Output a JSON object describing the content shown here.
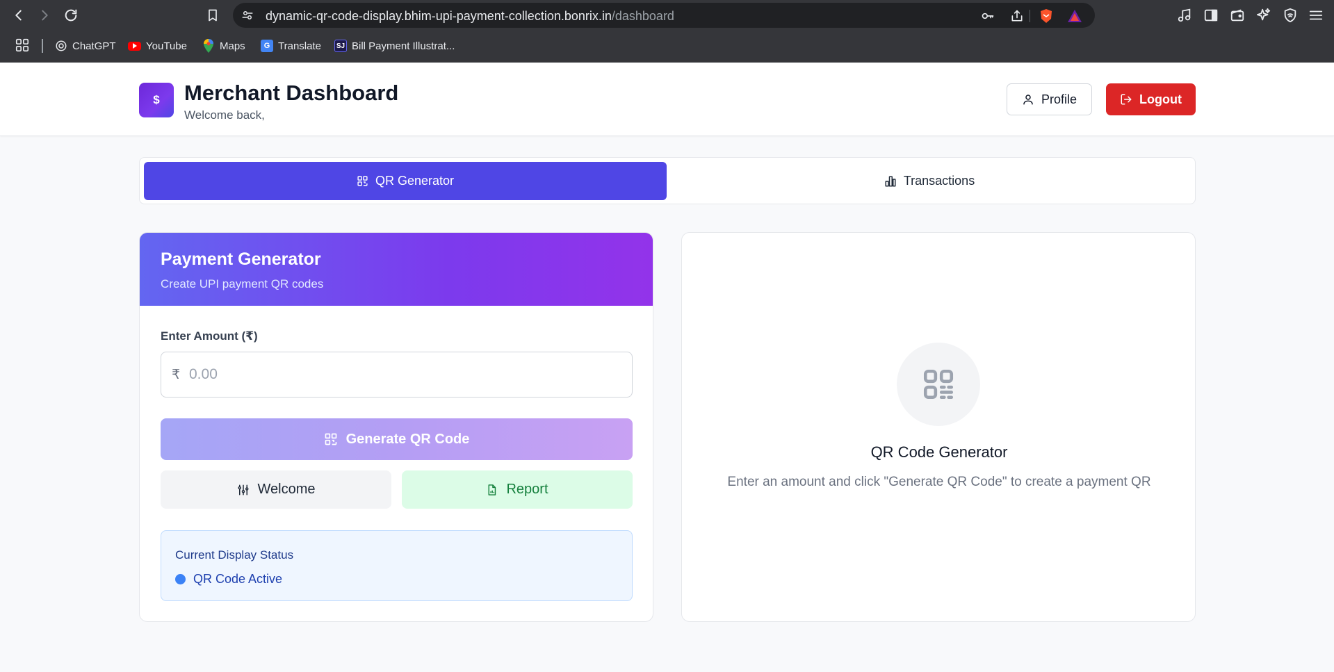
{
  "browser": {
    "url_host": "dynamic-qr-code-display.bhim-upi-payment-collection.bonrix.in",
    "url_path": "/dashboard",
    "bookmarks": [
      {
        "label": "ChatGPT",
        "icon": "chatgpt-icon"
      },
      {
        "label": "YouTube",
        "icon": "youtube-icon"
      },
      {
        "label": "Maps",
        "icon": "maps-icon"
      },
      {
        "label": "Translate",
        "icon": "translate-icon"
      },
      {
        "label": "Bill Payment Illustrat...",
        "icon": "bill-payment-icon"
      }
    ]
  },
  "header": {
    "logo_symbol": "$",
    "title": "Merchant Dashboard",
    "subtitle": "Welcome back,",
    "profile_label": "Profile",
    "logout_label": "Logout"
  },
  "tabs": [
    {
      "label": "QR Generator",
      "active": true,
      "icon": "qr-icon"
    },
    {
      "label": "Transactions",
      "active": false,
      "icon": "bar-chart-icon"
    }
  ],
  "generator": {
    "title": "Payment Generator",
    "subtitle": "Create UPI payment QR codes",
    "amount_label": "Enter Amount (₹)",
    "currency_symbol": "₹",
    "amount_placeholder": "0.00",
    "amount_value": "",
    "generate_label": "Generate QR Code",
    "welcome_label": "Welcome",
    "report_label": "Report",
    "status_title": "Current Display Status",
    "status_text": "QR Code Active"
  },
  "preview": {
    "title": "QR Code Generator",
    "description": "Enter an amount and click \"Generate QR Code\" to create a payment QR"
  },
  "colors": {
    "primary": "#4f46e5",
    "logout": "#dc2626",
    "report_bg": "#dcfce7",
    "status_dot": "#3b82f6"
  }
}
